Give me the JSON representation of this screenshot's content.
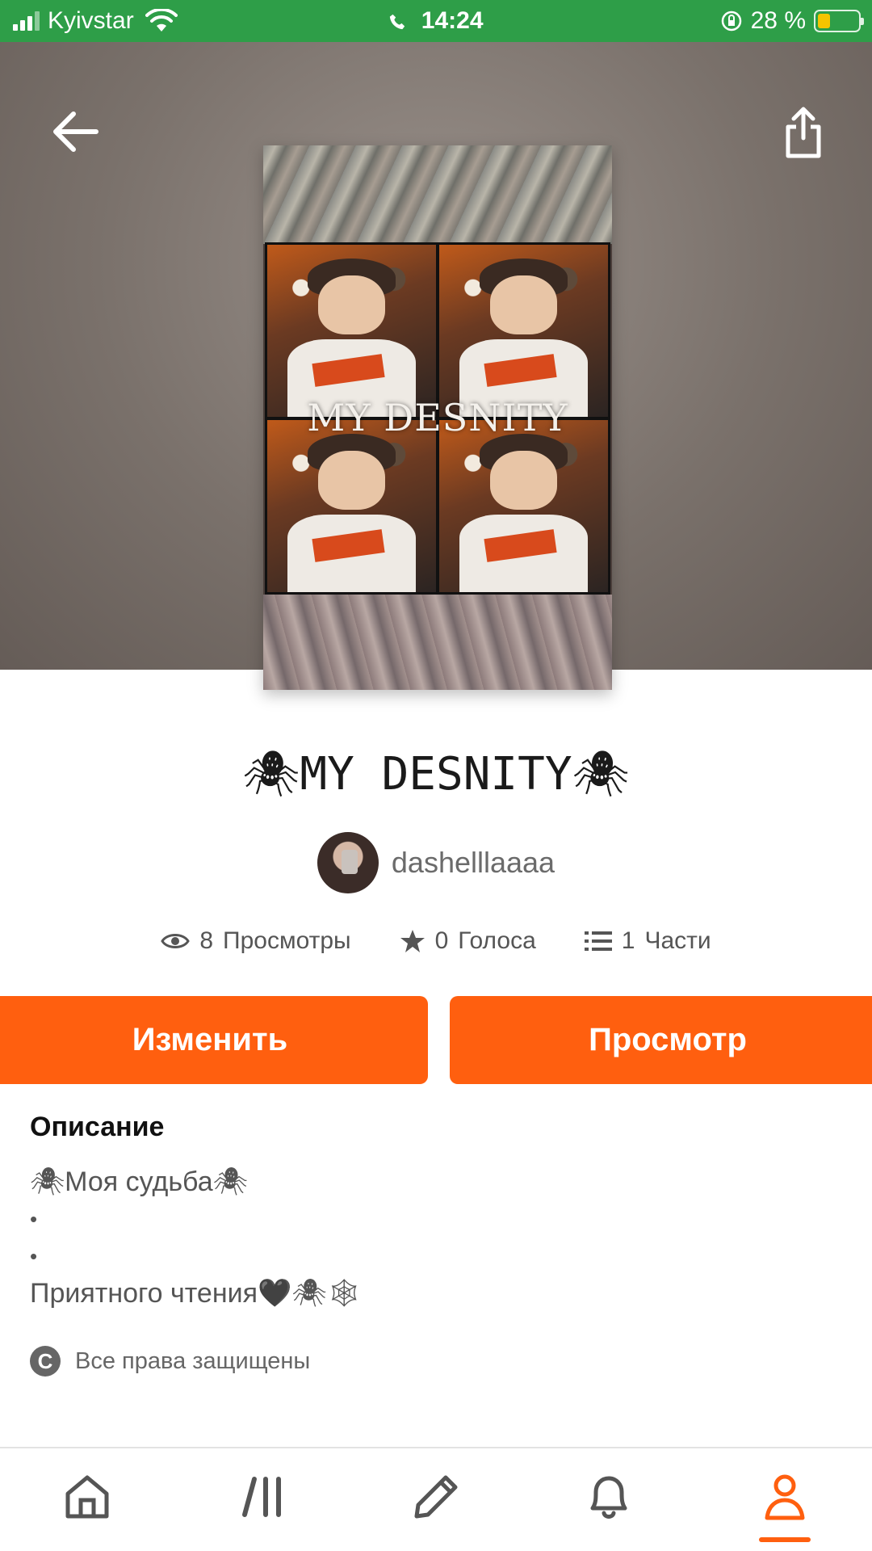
{
  "status_bar": {
    "carrier": "Kyivstar",
    "time": "14:24",
    "battery_percent": "28 %",
    "battery_level": 0.28,
    "icons": [
      "signal-icon",
      "wifi-icon",
      "phone-icon",
      "rotation-lock-icon",
      "battery-icon"
    ]
  },
  "header": {
    "back_icon": "arrow-left-icon",
    "share_icon": "share-icon"
  },
  "cover": {
    "title_text": "MY DESNITY"
  },
  "story": {
    "title": "🕷MY DESNITY🕷",
    "author": "dashelllaaaa"
  },
  "stats": {
    "views_count": "8",
    "views_label": "Просмотры",
    "votes_count": "0",
    "votes_label": "Голоса",
    "parts_count": "1",
    "parts_label": "Части"
  },
  "actions": {
    "edit_label": "Изменить",
    "preview_label": "Просмотр"
  },
  "description": {
    "heading": "Описание",
    "lines": [
      "🕷Моя судьба🕷",
      "•",
      "•",
      "Приятного чтения🖤🕷🕸"
    ],
    "rights": "Все права защищены"
  },
  "bottom_nav": {
    "items": [
      "home-icon",
      "library-icon",
      "write-icon",
      "notifications-icon",
      "profile-icon"
    ],
    "active": "profile-icon"
  },
  "colors": {
    "status_green": "#2e9e48",
    "accent": "#ff5f0f",
    "battery_yellow": "#f5c400"
  }
}
